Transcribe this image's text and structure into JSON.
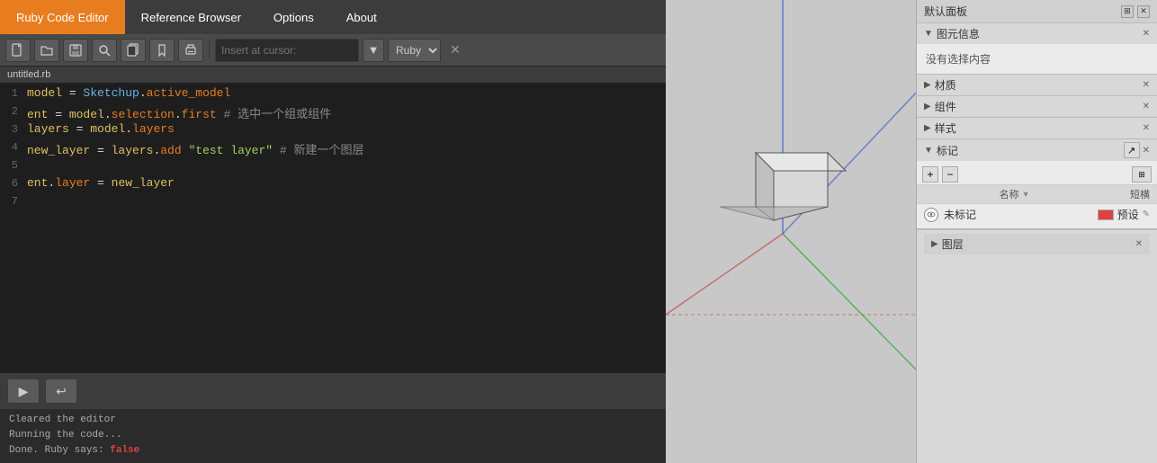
{
  "menu": {
    "items": [
      {
        "id": "ruby-code-editor",
        "label": "Ruby Code Editor",
        "active": true
      },
      {
        "id": "reference-browser",
        "label": "Reference Browser",
        "active": false
      },
      {
        "id": "options",
        "label": "Options",
        "active": false
      },
      {
        "id": "about",
        "label": "About",
        "active": false
      }
    ]
  },
  "toolbar": {
    "insert_placeholder": "Insert at cursor:",
    "language": "Ruby",
    "icons": {
      "new": "🗋",
      "open": "🗁",
      "save": "💾",
      "search": "🔍",
      "copy": "⧉",
      "pin": "📌",
      "print": "🖨"
    }
  },
  "file_tab": {
    "name": "untitled.rb"
  },
  "code": {
    "lines": [
      {
        "num": 1,
        "content": "model = Sketchup.active_model"
      },
      {
        "num": 2,
        "content": "ent = model.selection.first  # 选中一个组或组件"
      },
      {
        "num": 3,
        "content": "layers = model.layers"
      },
      {
        "num": 4,
        "content": "new_layer = layers.add \"test layer\"  # 新建一个图层"
      },
      {
        "num": 5,
        "content": ""
      },
      {
        "num": 6,
        "content": "ent.layer = new_layer"
      },
      {
        "num": 7,
        "content": ""
      }
    ]
  },
  "run_buttons": {
    "run_label": "▶",
    "undo_label": "↩"
  },
  "status": {
    "line1": "Cleared the editor",
    "line2": "Running the code...",
    "line3_prefix": "Done. Ruby says: ",
    "line3_value": "false"
  },
  "right_panel": {
    "title": "默认面板",
    "sections": {
      "entity_info": {
        "title": "图元信息",
        "no_selection": "没有选择内容"
      },
      "materials": {
        "title": "材质"
      },
      "components": {
        "title": "组件"
      },
      "styles": {
        "title": "样式"
      },
      "tags": {
        "title": "标记",
        "columns": [
          "名称",
          "短横"
        ],
        "rows": [
          {
            "eye": true,
            "name": "未标记",
            "color": "#e04040",
            "preset": "预设"
          }
        ],
        "buttons": [
          "+",
          "−",
          "↺"
        ]
      },
      "layers": {
        "title": "图层"
      }
    }
  }
}
